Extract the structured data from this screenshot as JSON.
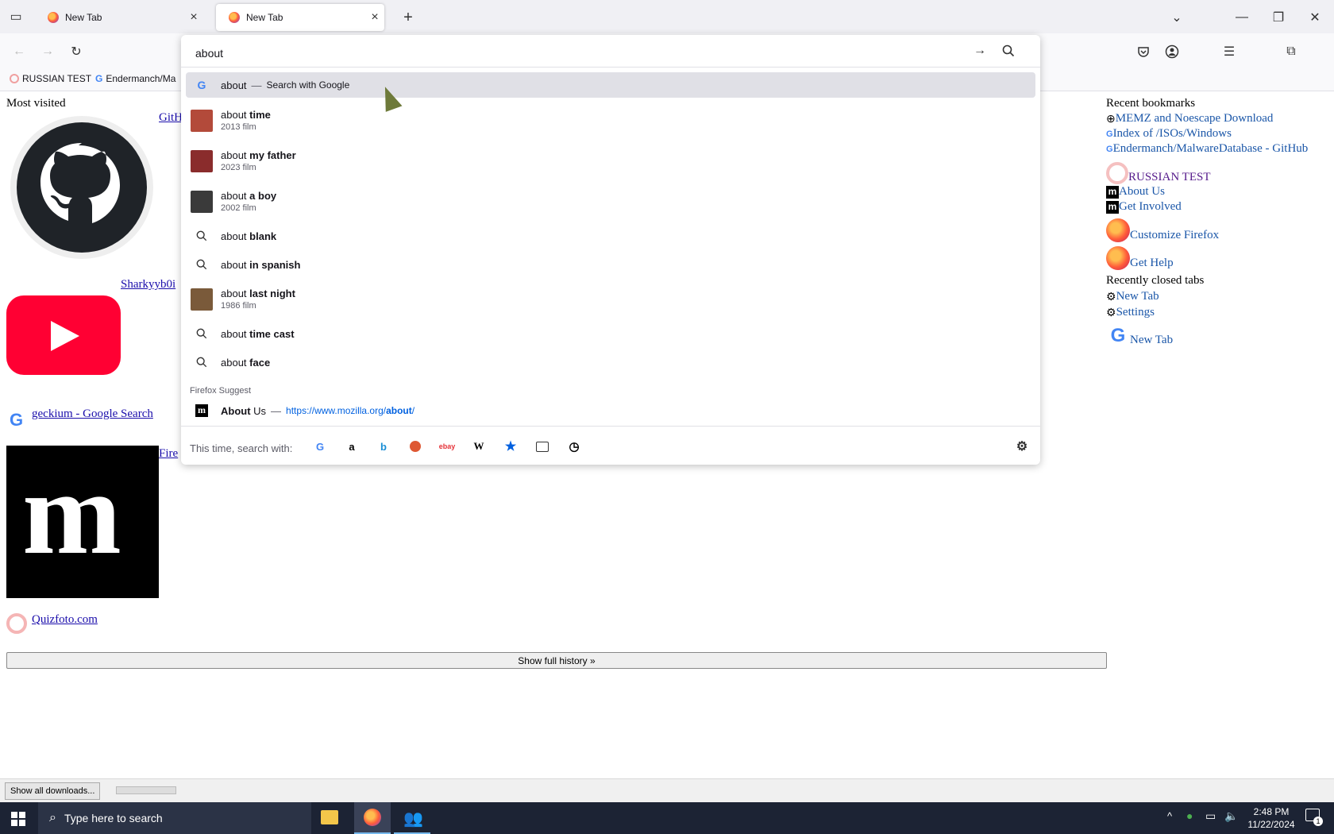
{
  "tabs": [
    {
      "label": "New Tab",
      "close": "×"
    },
    {
      "label": "New Tab",
      "close": "×"
    }
  ],
  "tabbar": {
    "new_tab": "+"
  },
  "window_controls": {
    "minimize": "—",
    "restore": "❐",
    "close": "✕"
  },
  "urlbar": {
    "value": "about"
  },
  "bookmarks_toolbar": [
    {
      "label": "RUSSIAN TEST"
    },
    {
      "label": "Endermanch/Ma"
    }
  ],
  "suggestions": {
    "top": {
      "prefix": "about",
      "suffix": "Search with Google"
    },
    "items": [
      {
        "prefix": "about",
        "bold": "time",
        "sub": "2013 film",
        "kind": "thumb",
        "color": "#b34a3a"
      },
      {
        "prefix": "about",
        "bold": "my father",
        "sub": "2023 film",
        "kind": "thumb",
        "color": "#8a2c2c"
      },
      {
        "prefix": "about",
        "bold": "a boy",
        "sub": "2002 film",
        "kind": "thumb",
        "color": "#3a3a3a"
      },
      {
        "prefix": "about",
        "bold": "blank",
        "sub": "",
        "kind": "search"
      },
      {
        "prefix": "about",
        "bold": "in spanish",
        "sub": "",
        "kind": "search"
      },
      {
        "prefix": "about",
        "bold": "last night",
        "sub": "1986 film",
        "kind": "thumb",
        "color": "#7a5a3a"
      },
      {
        "prefix": "about",
        "bold": "time cast",
        "sub": "",
        "kind": "search"
      },
      {
        "prefix": "about",
        "bold": "face",
        "sub": "",
        "kind": "search"
      }
    ],
    "group_label": "Firefox Suggest",
    "firefox_suggest": {
      "title_bold": "About",
      "title_rest": " Us",
      "url_start": "https://www.mozilla.org/",
      "url_bold": "about",
      "url_end": "/"
    },
    "search_with_label": "This time, search with:",
    "engines": [
      "google-icon",
      "amazon-icon",
      "bing-icon",
      "duckduckgo-icon",
      "ebay-icon",
      "wikipedia-icon",
      "bookmarks-icon",
      "tabs-icon",
      "history-icon"
    ]
  },
  "page": {
    "most_visited_title": "Most visited",
    "tiles": [
      {
        "label": "GitH"
      },
      {
        "label": "Sharkyyb0i"
      },
      {
        "label": "geckium - Google Search"
      },
      {
        "label": "Fire"
      },
      {
        "label": "Quizfoto.com"
      }
    ],
    "show_full_history": "Show full history »",
    "recent_bookmarks_title": "Recent bookmarks",
    "recent_bookmarks": [
      "MEMZ and Noescape Download",
      "Index of /ISOs/Windows",
      "Endermanch/MalwareDatabase - GitHub",
      "RUSSIAN TEST",
      "About Us",
      "Get Involved",
      "Customize Firefox",
      "Get Help"
    ],
    "recently_closed_title": "Recently closed tabs",
    "recently_closed": [
      "New Tab",
      "Settings",
      "New Tab"
    ]
  },
  "downloads": {
    "show_all": "Show all downloads..."
  },
  "taskbar": {
    "search_placeholder": "Type here to search",
    "time": "2:48 PM",
    "date": "11/22/2024",
    "notification_count": "1"
  }
}
